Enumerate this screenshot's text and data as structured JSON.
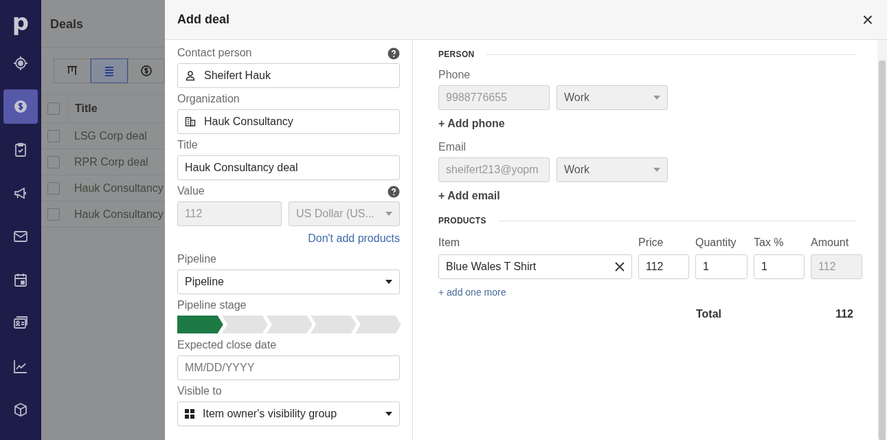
{
  "sidebar": {
    "logo": "p",
    "items": [
      {
        "selected": false
      },
      {
        "selected": true
      },
      {
        "selected": false
      },
      {
        "selected": false
      },
      {
        "selected": false
      },
      {
        "selected": false
      },
      {
        "selected": false
      },
      {
        "selected": false
      },
      {
        "selected": false
      }
    ]
  },
  "background": {
    "title": "Deals",
    "views": [
      {
        "selected": false
      },
      {
        "selected": true
      },
      {
        "selected": false
      }
    ],
    "table": {
      "header": "Title",
      "all_checked": false,
      "rows": [
        {
          "title": "LSG Corp deal",
          "checked": false
        },
        {
          "title": "RPR Corp deal",
          "checked": false
        },
        {
          "title": "Hauk Consultancy",
          "checked": false
        },
        {
          "title": "Hauk Consultancy",
          "checked": false
        }
      ]
    }
  },
  "dialog": {
    "title": "Add deal",
    "close": "×",
    "left": {
      "contact_label": "Contact person",
      "contact_value": "Sheifert Hauk",
      "org_label": "Organization",
      "org_value": "Hauk Consultancy",
      "title_label": "Title",
      "title_value": "Hauk Consultancy deal",
      "value_label": "Value",
      "value_value": "112",
      "currency": "US Dollar (US...",
      "dont_add_link": "Don't add products",
      "pipeline_label": "Pipeline",
      "pipeline_value": "Pipeline",
      "stage_label": "Pipeline stage",
      "stages": [
        {
          "selected": true
        },
        {
          "selected": false
        },
        {
          "selected": false
        },
        {
          "selected": false
        },
        {
          "selected": false
        }
      ],
      "close_date_label": "Expected close date",
      "close_date_placeholder": "MM/DD/YYYY",
      "visible_label": "Visible to",
      "visible_value": "Item owner's visibility group"
    },
    "right": {
      "person_heading": "PERSON",
      "phone_label": "Phone",
      "phone_value": "9988776655",
      "phone_type": "Work",
      "add_phone": "+ Add phone",
      "email_label": "Email",
      "email_value": "sheifert213@yopm",
      "email_type": "Work",
      "add_email": "+ Add email",
      "products_heading": "PRODUCTS",
      "columns": [
        "Item",
        "Price",
        "Quantity",
        "Tax %",
        "Amount"
      ],
      "product": {
        "item": "Blue Wales T Shirt",
        "price": "112",
        "quantity": "1",
        "tax": "1",
        "amount": "112"
      },
      "add_more": "+ add one more",
      "total_label": "Total",
      "total_value": "112"
    }
  }
}
